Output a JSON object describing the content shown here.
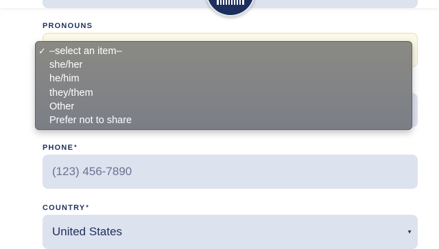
{
  "pronouns": {
    "label": "PRONOUNS",
    "options": [
      {
        "label": "–select an item–",
        "selected": true
      },
      {
        "label": "she/her",
        "selected": false
      },
      {
        "label": "he/him",
        "selected": false
      },
      {
        "label": "they/them",
        "selected": false
      },
      {
        "label": "Other",
        "selected": false
      },
      {
        "label": "Prefer not to share",
        "selected": false
      }
    ],
    "check_glyph": "✓"
  },
  "phone": {
    "label": "PHONE",
    "required_mark": "*",
    "placeholder": "(123) 456-7890"
  },
  "country": {
    "label": "COUNTRY",
    "required_mark": "*",
    "value": "United States"
  },
  "icons": {
    "select_arrow": "chevron-down-icon",
    "seal": "seal-logo"
  },
  "colors": {
    "brand_navy": "#1d2f5c",
    "input_bg": "#dde2ef",
    "dropdown_bg": "#7f8186"
  }
}
